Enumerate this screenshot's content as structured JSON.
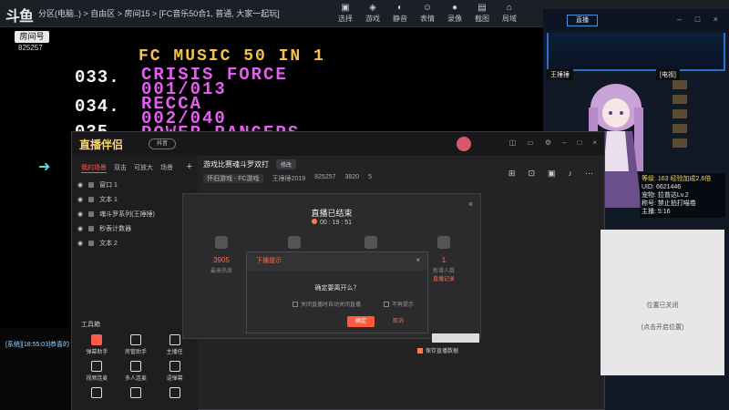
{
  "topbar": {
    "logo": "斗鱼",
    "breadcrumb": "分区(电脑..) > 自由区 > 房间15 > [FC音乐50合1, 普通, 大家一起玩]",
    "icons": [
      {
        "label": "选择",
        "icon": "select-icon"
      },
      {
        "label": "游戏",
        "icon": "gamepad-icon"
      },
      {
        "label": "静音",
        "icon": "mute-icon"
      },
      {
        "label": "表情",
        "icon": "emoji-icon"
      },
      {
        "label": "录像",
        "icon": "record-icon"
      },
      {
        "label": "截图",
        "icon": "screenshot-icon"
      },
      {
        "label": "局域",
        "icon": "lan-icon"
      }
    ]
  },
  "room": {
    "label": "房间号",
    "id": "825257"
  },
  "game": {
    "title": "FC MUSIC 50 IN 1",
    "entries": [
      {
        "num": "033.",
        "name": "CRISIS FORCE",
        "track": "001/013"
      },
      {
        "num": "034.",
        "name": "RECCA",
        "track": "002/040"
      },
      {
        "num": "035.",
        "name": "POWER RANGERS",
        "track": ""
      }
    ],
    "status": "[系统][18:55:03]恭喜的"
  },
  "preview": {
    "button": "直播",
    "name_left": "王捶捶",
    "name_right": "[电视]",
    "stats": [
      "等级: 163 经验加成2.6倍",
      "UID: 6621446",
      "宠物: 拉普达Lv.2",
      "称号: 禁止拍打喵卷",
      "主播: 5:16"
    ]
  },
  "window": {
    "logo": "直播伴侣",
    "tag": "抖音",
    "tabs": [
      "我的场景",
      "双击",
      "可放大",
      "场景"
    ],
    "sources": [
      "窗口 1",
      "文本 1",
      "魂斗罗系列(王捶捶)",
      "秒表计数器",
      "文本 2"
    ],
    "tools_title": "工具箱",
    "tools": [
      "弹幕助手",
      "房管助手",
      "主播任",
      "视频连麦",
      "多人连麦",
      "语弹幕",
      "",
      "",
      ""
    ],
    "stream_title": "游戏比赛魂斗罗双打",
    "edit": "修改",
    "info": [
      "怀旧游戏 - FC游戏",
      "王捶捶2019",
      "825257",
      "3820",
      "5"
    ]
  },
  "end_dialog": {
    "title": "直播已结束",
    "time": "00 : 19 : 51",
    "stats": [
      {
        "val": "3905",
        "label": "最高热度"
      },
      {
        "val": "",
        "label": ""
      },
      {
        "val": "",
        "label": ""
      },
      {
        "val": "1",
        "label": "新增人数",
        "link": "直播记录"
      }
    ]
  },
  "confirm": {
    "header": "下播提示",
    "question": "确定要离开么？",
    "opt1": "关闭直播时自动关闭直播",
    "opt2": "不再提示",
    "ok": "确定",
    "cancel": "取消"
  },
  "save": {
    "label": "保存直播数据"
  },
  "msg_tile": {
    "line1": "位置已关闭",
    "line2": "(点击开启位置)"
  },
  "colors": {
    "accent": "#ff5a4e",
    "game_title": "#f4c44a",
    "game_name": "#e45ef0"
  }
}
